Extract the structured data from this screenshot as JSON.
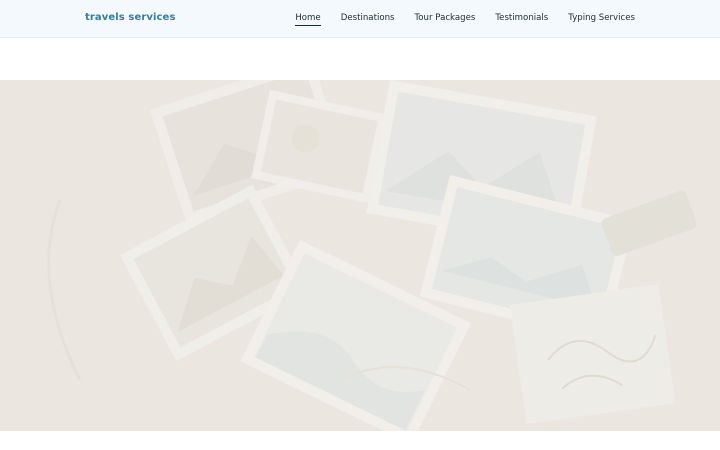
{
  "brand": {
    "name": "travels services"
  },
  "nav": {
    "items": [
      {
        "label": "Home",
        "active": true
      },
      {
        "label": "Destinations",
        "active": false
      },
      {
        "label": "Tour Packages",
        "active": false
      },
      {
        "label": "Testimonials",
        "active": false
      },
      {
        "label": "Typing Services",
        "active": false
      }
    ]
  },
  "colors": {
    "brand": "#2f7fa6",
    "navbar_bg": "#f3f9fd",
    "nav_text": "#1f2a30",
    "hero_overlay": "#efece7"
  }
}
